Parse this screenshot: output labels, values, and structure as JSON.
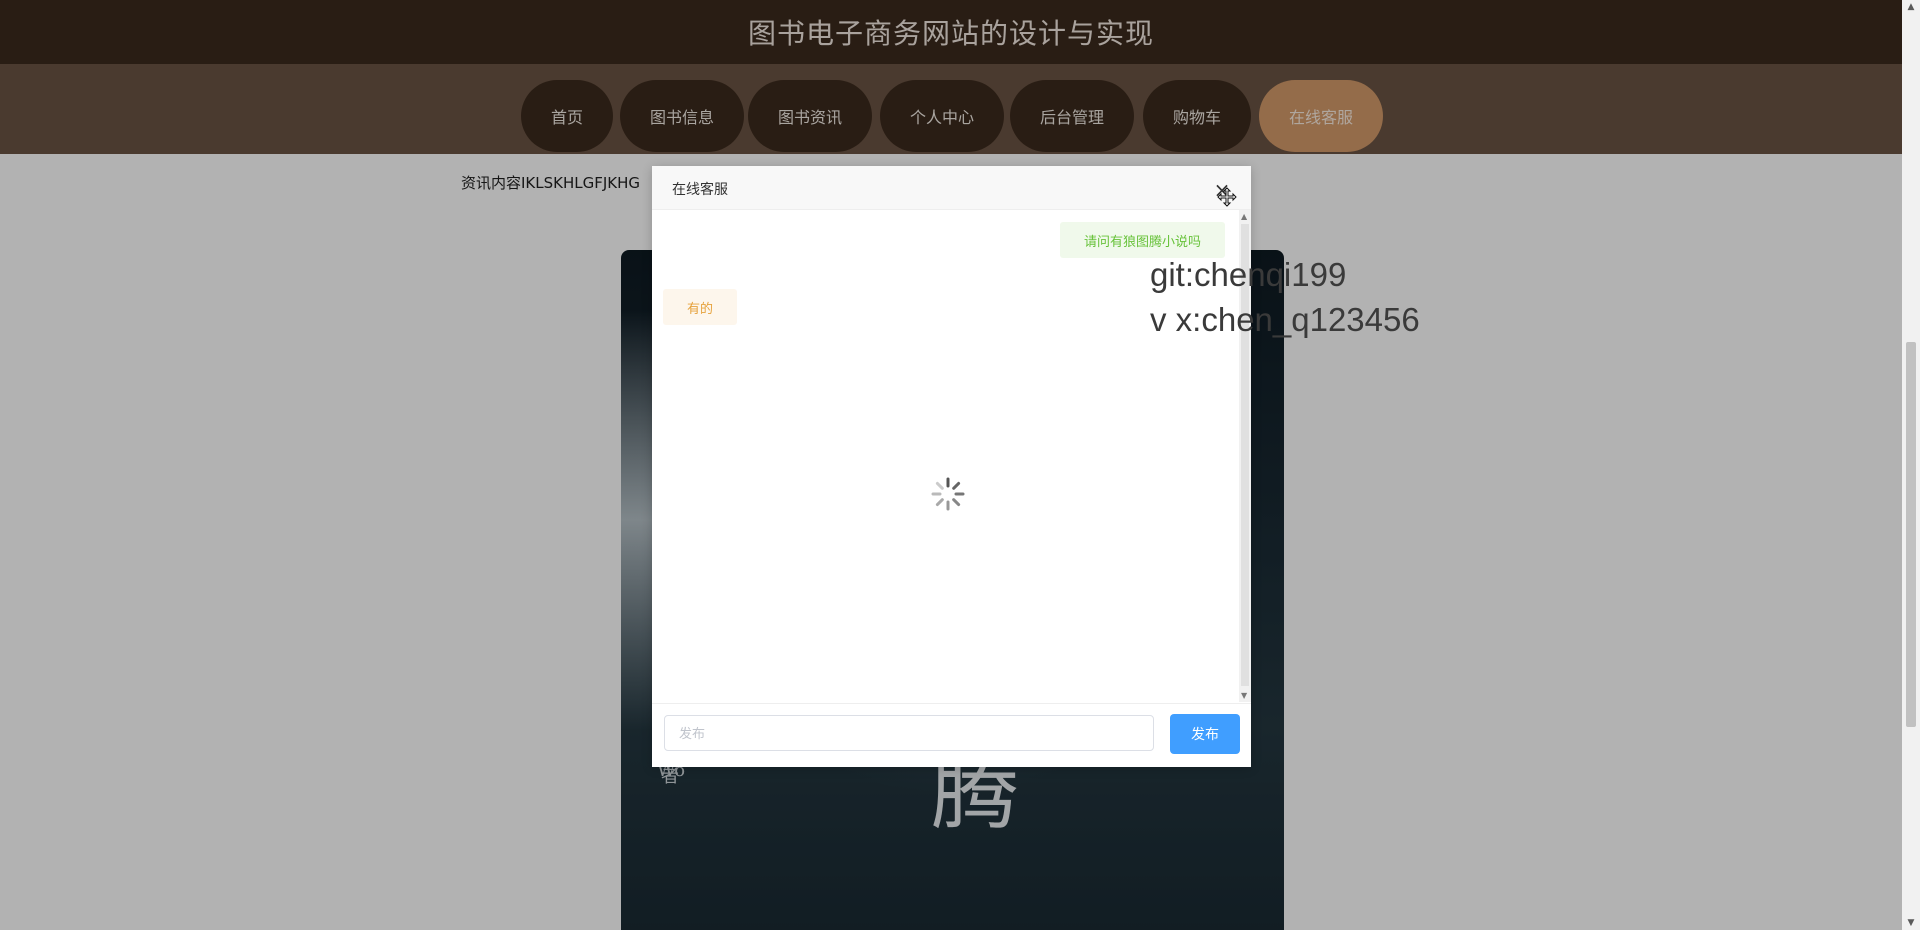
{
  "site": {
    "title": "图书电子商务网站的设计与实现"
  },
  "nav": {
    "items": [
      {
        "label": "首页"
      },
      {
        "label": "图书信息"
      },
      {
        "label": "图书资讯"
      },
      {
        "label": "个人中心"
      },
      {
        "label": "后台管理"
      },
      {
        "label": "购物车"
      },
      {
        "label": "在线客服"
      }
    ],
    "active": "在线客服"
  },
  "content": {
    "news_text": "资讯内容IKLSKHLGFJKHG",
    "cover_char": "腾",
    "cover_small": "Wo",
    "cover_author_char": "者"
  },
  "watermark": {
    "line1": "git:chenqi199",
    "line2": "v x:chen_q123456"
  },
  "dialog": {
    "title": "在线客服",
    "close_icon": "×",
    "messages": [
      {
        "side": "right",
        "text": "请问有狼图腾小说吗"
      },
      {
        "side": "left",
        "text": "有的"
      }
    ],
    "input_placeholder": "发布",
    "send_label": "发布"
  },
  "colors": {
    "topbar": "#3c2a1d",
    "navbar": "#6a5444",
    "nav_active": "#d59b6a",
    "send_button": "#409eff",
    "user_msg_bg": "#f0f9eb",
    "user_msg_text": "#67c23a",
    "agent_msg_bg": "#fdf6ec",
    "agent_msg_text": "#e6a23c"
  }
}
